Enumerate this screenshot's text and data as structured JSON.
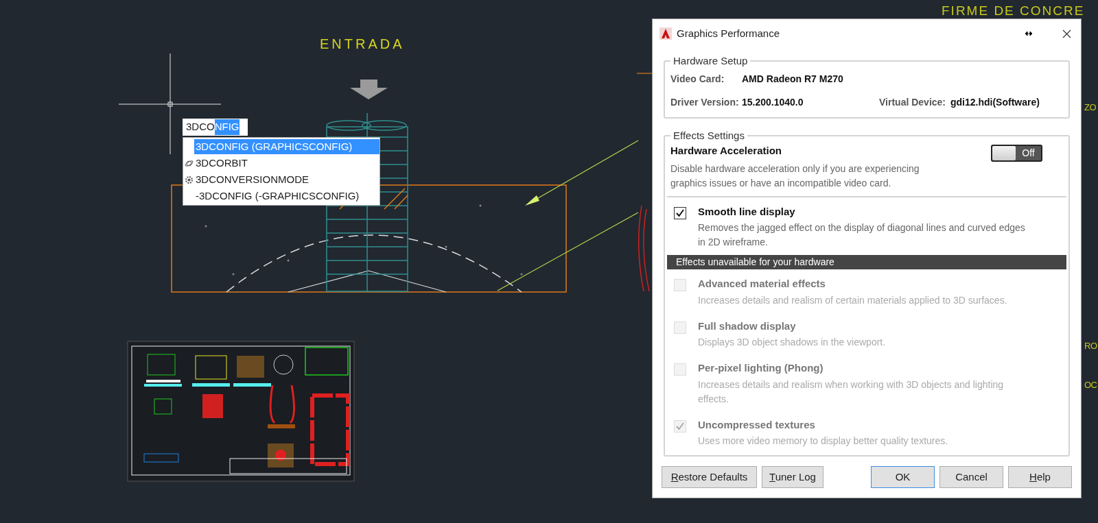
{
  "drawing": {
    "entrance_label": "ENTRADA",
    "edge_labels": [
      "FIRME DE CONCRE",
      "ZO",
      "RO",
      "OC"
    ]
  },
  "command_input": {
    "typed": "3DCO",
    "completion": "NFIG"
  },
  "suggestions": [
    {
      "label": "3DCONFIG (GRAPHICSCONFIG)",
      "selected": true,
      "kind": "alias"
    },
    {
      "label": "3DCORBIT",
      "selected": false,
      "kind": "command"
    },
    {
      "label": "3DCONVERSIONMODE",
      "selected": false,
      "kind": "sysvar"
    },
    {
      "label": "-3DCONFIG (-GRAPHICSCONFIG)",
      "selected": false,
      "kind": "alias"
    }
  ],
  "dialog": {
    "title": "Graphics Performance",
    "hardware_setup": {
      "title": "Hardware Setup",
      "rows": [
        [
          {
            "label": "Video Card:",
            "value": "AMD Radeon R7 M270"
          }
        ],
        [
          {
            "label": "Driver Version:",
            "value": "15.200.1040.0"
          },
          {
            "label": "Virtual Device:",
            "value": "gdi12.hdi(Software)"
          }
        ]
      ]
    },
    "effects_settings": {
      "title": "Effects Settings",
      "hardware_acceleration": {
        "title": "Hardware Acceleration",
        "description": "Disable hardware acceleration only if you are experiencing graphics issues or have an incompatible video card.",
        "toggle": {
          "on": false,
          "label": "Off"
        }
      },
      "options": [
        {
          "label": "Smooth line display",
          "description": "Removes the jagged effect on the display of diagonal lines and curved edges in 2D wireframe.",
          "checked": true,
          "disabled": false
        }
      ],
      "unavailable": {
        "header": "Effects unavailable for your hardware",
        "options": [
          {
            "label": "Advanced material effects",
            "description": "Increases details and realism of certain materials applied to 3D surfaces.",
            "checked": false,
            "disabled": true
          },
          {
            "label": "Full shadow display",
            "description": "Displays 3D object shadows in the viewport.",
            "checked": false,
            "disabled": true
          },
          {
            "label": "Per-pixel lighting (Phong)",
            "description": "Increases details and realism when working with 3D objects and lighting effects.",
            "checked": false,
            "disabled": true
          },
          {
            "label": "Uncompressed textures",
            "description": "Uses more video memory to display better quality textures.",
            "checked": true,
            "disabled": true
          }
        ]
      }
    },
    "buttons": [
      {
        "label": "Restore Defaults",
        "underline_first": true,
        "default": false
      },
      {
        "label": "Tuner Log",
        "underline_first": true,
        "default": false
      },
      {
        "label": "OK",
        "underline_first": false,
        "default": true
      },
      {
        "label": "Cancel",
        "underline_first": false,
        "default": false
      },
      {
        "label": "Help",
        "underline_first": true,
        "default": false
      }
    ]
  }
}
